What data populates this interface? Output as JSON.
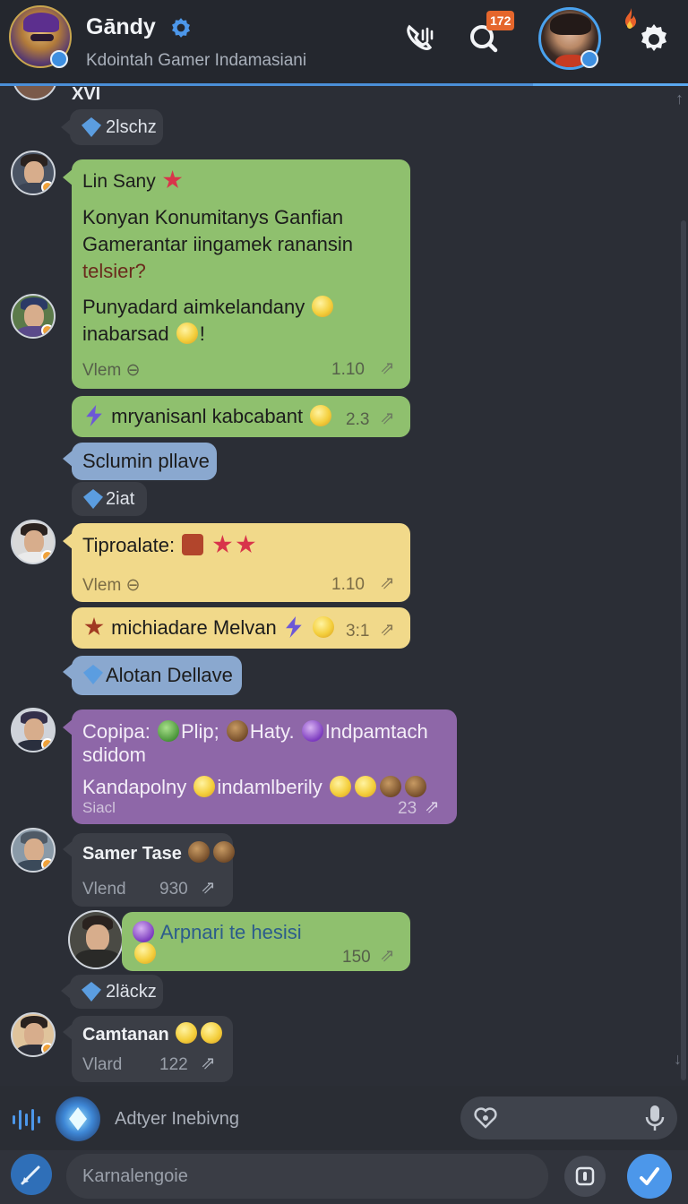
{
  "header": {
    "title": "Gāndy",
    "subtitle": "Kdointah Gamer Indamasiani",
    "notification_badge": "172",
    "icons": [
      "verified-gear-icon",
      "phone-icon",
      "search-icon",
      "fire-icon",
      "settings-icon"
    ]
  },
  "chat": {
    "top_partial_text": "XVI",
    "messages": [
      {
        "type": "system",
        "icon": "gem-icon",
        "text": "2lschz"
      },
      {
        "type": "bubble",
        "color": "green",
        "sender": "Lin Sany",
        "lines": [
          "Konyan Konumitanys Ganfian",
          "Gamerantar iingamek  ranansin",
          "telsier?"
        ],
        "lines2": [
          "Punyadard aimkelandany",
          "inabarsad"
        ],
        "meta_left": "Vlem",
        "time": "1.10"
      },
      {
        "type": "bubble",
        "color": "green",
        "text": "mryanisanl kabcabant",
        "time": "2.3"
      },
      {
        "type": "bubble",
        "color": "blue",
        "text": "Sclumin pllave"
      },
      {
        "type": "system",
        "icon": "gem-icon",
        "text": "2iat"
      },
      {
        "type": "bubble",
        "color": "yellow",
        "text": "Tiproalate:",
        "meta_left": "Vlem",
        "time": "1.10"
      },
      {
        "type": "bubble",
        "color": "yellow",
        "text": "michiadare Melvan",
        "time": "3:1"
      },
      {
        "type": "bubble",
        "color": "blue",
        "text": "Alotan Dellave"
      },
      {
        "type": "bubble",
        "color": "purple",
        "line1": "Copipa:",
        "line1b": "Plip;",
        "line1c": "Haty.",
        "line1d": "Indpamtach",
        "line2": "sdidom",
        "line3": "Kandapolny",
        "line3b": "indamlberily",
        "meta_left": "Siacl",
        "time": "23"
      },
      {
        "type": "bubble",
        "color": "dark",
        "text": "Samer Tase",
        "meta_left": "Vlend",
        "time": "930"
      },
      {
        "type": "bubble",
        "color": "green",
        "text": "Arpnari te hesisi",
        "time": "150"
      },
      {
        "type": "system",
        "icon": "gem-icon",
        "text": "2läckz"
      },
      {
        "type": "bubble",
        "color": "dark",
        "text": "Camtanan",
        "meta_left": "Vlard",
        "time": "122"
      }
    ]
  },
  "composer": {
    "top_placeholder": "Adtyer Inebivng",
    "bottom_placeholder": "Karnalengoie"
  },
  "colors": {
    "accent": "#4b8fd8",
    "green_bubble": "#8fc06e",
    "yellow_bubble": "#f1d98a",
    "purple_bubble": "#8e67a8",
    "blue_bubble": "#8aa8cf",
    "background": "#2b2e36"
  }
}
